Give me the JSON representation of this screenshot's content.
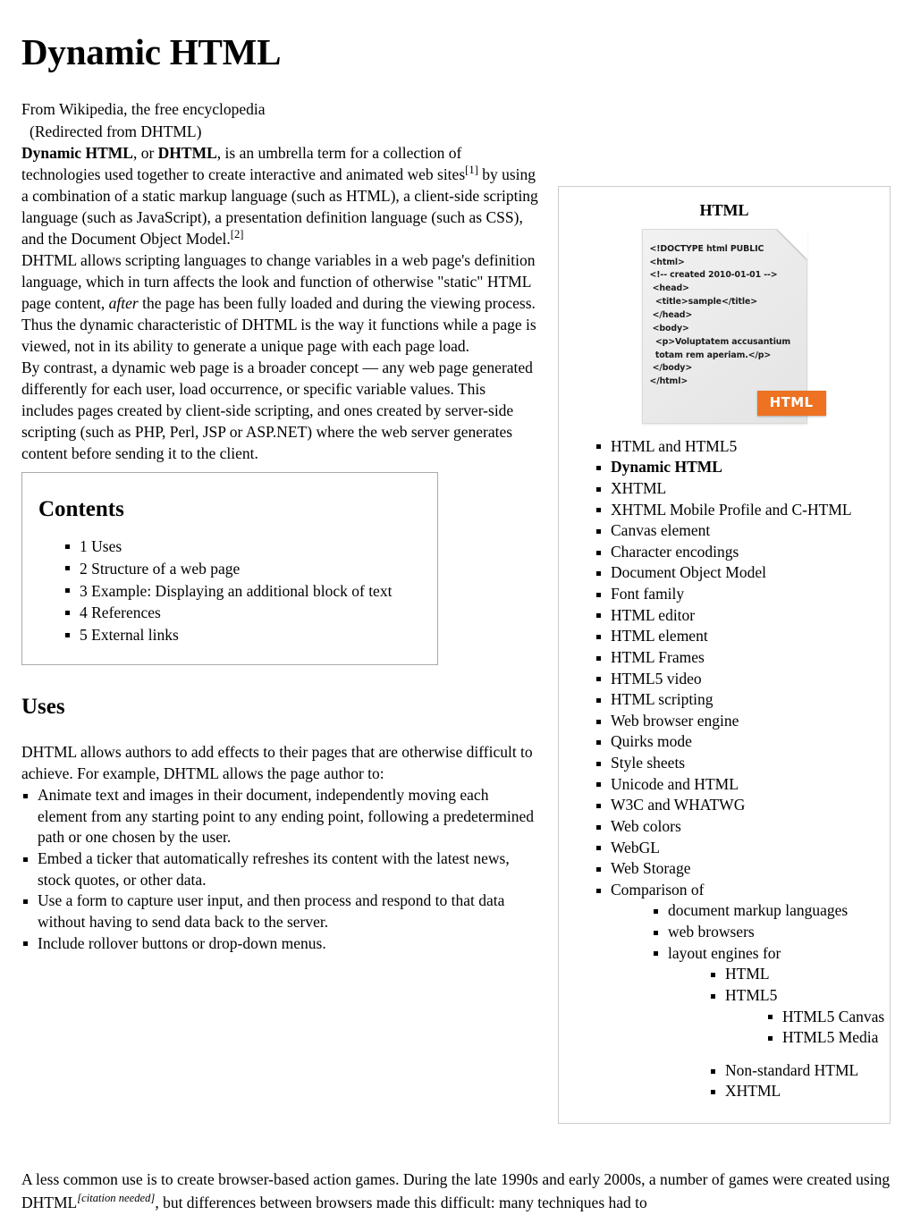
{
  "article": {
    "title": "Dynamic HTML",
    "site_line": "From Wikipedia, the free encyclopedia",
    "redirect_line": "(Redirected from DHTML)"
  },
  "lead": {
    "p1_bold_1": "Dynamic HTML",
    "p1_seg_1": ", or ",
    "p1_bold_2": "DHTML",
    "p1_seg_2": ", is an umbrella term for a collection of technologies used together to create interactive and animated web sites",
    "p1_ref_1": "[1]",
    "p1_seg_3": " by using a combination of a static markup language (such as HTML), a client-side scripting language (such as JavaScript), a presentation definition language (such as CSS), and the Document Object Model.",
    "p1_ref_2": "[2]",
    "p2_seg_1": "DHTML allows scripting languages to change variables in a web page's definition language, which in turn affects the look and function of otherwise \"static\" HTML page content, ",
    "p2_italic": "after",
    "p2_seg_2": " the page has been fully loaded and during the viewing process. Thus the dynamic characteristic of DHTML is the way it functions while a page is viewed, not in its ability to generate a unique page with each page load.",
    "p3": "By contrast, a dynamic web page is a broader concept — any web page generated differently for each user, load occurrence, or specific variable values. This includes pages created by client-side scripting, and ones created by server-side scripting (such as PHP, Perl, JSP or ASP.NET) where the web server generates content before sending it to the client."
  },
  "toc": {
    "heading": "Contents",
    "items": [
      "1 Uses",
      "2 Structure of a web page",
      "3 Example: Displaying an additional block of text",
      "4 References",
      "5 External links"
    ]
  },
  "uses_section": {
    "heading": "Uses",
    "intro": "DHTML allows authors to add effects to their pages that are otherwise difficult to achieve. For example, DHTML allows the page author to:",
    "items": [
      "Animate text and images in their document, independently moving each element from any starting point to any ending point, following a predetermined path or one chosen by the user.",
      "Embed a ticker that automatically refreshes its content with the latest news, stock quotes, or other data.",
      "Use a form to capture user input, and then process and respond to that data without having to send data back to the server.",
      "Include rollover buttons or drop-down menus."
    ]
  },
  "bottom_paragraph": {
    "seg_1": "A less common use is to create browser-based action games. During the late 1990s and early 2000s, a number of games were created using DHTML",
    "citation_needed": "[citation needed]",
    "seg_2": ", but differences between browsers made this difficult: many techniques had to"
  },
  "infobox": {
    "title": "HTML",
    "doc_code": "<!DOCTYPE html PUBLIC\n<html>\n<!-- created 2010-01-01 -->\n <head>\n  <title>sample</title>\n </head>\n <body>\n  <p>Voluptatem accusantium\n  totam rem aperiam.</p>\n </body>\n</html>",
    "badge_label": "HTML",
    "badge_color": "#ED7222",
    "nav_items": [
      {
        "label": "HTML and HTML5",
        "level": 1,
        "current": false
      },
      {
        "label": "Dynamic HTML",
        "level": 1,
        "current": true
      },
      {
        "label": "XHTML",
        "level": 1,
        "current": false
      },
      {
        "label": "XHTML Mobile Profile and C-HTML",
        "level": 1,
        "current": false
      },
      {
        "label": "Canvas element",
        "level": 1,
        "current": false
      },
      {
        "label": "Character encodings",
        "level": 1,
        "current": false
      },
      {
        "label": "Document Object Model",
        "level": 1,
        "current": false
      },
      {
        "label": "Font family",
        "level": 1,
        "current": false
      },
      {
        "label": "HTML editor",
        "level": 1,
        "current": false
      },
      {
        "label": "HTML element",
        "level": 1,
        "current": false
      },
      {
        "label": "HTML Frames",
        "level": 1,
        "current": false
      },
      {
        "label": "HTML5 video",
        "level": 1,
        "current": false
      },
      {
        "label": "HTML scripting",
        "level": 1,
        "current": false
      },
      {
        "label": "Web browser engine",
        "level": 1,
        "current": false
      },
      {
        "label": "Quirks mode",
        "level": 1,
        "current": false
      },
      {
        "label": "Style sheets",
        "level": 1,
        "current": false
      },
      {
        "label": "Unicode and HTML",
        "level": 1,
        "current": false
      },
      {
        "label": "W3C and WHATWG",
        "level": 1,
        "current": false
      },
      {
        "label": "Web colors",
        "level": 1,
        "current": false
      },
      {
        "label": "WebGL",
        "level": 1,
        "current": false
      },
      {
        "label": "Web Storage",
        "level": 1,
        "current": false
      },
      {
        "label": "Comparison of",
        "level": 1,
        "current": false
      },
      {
        "label": "document markup languages",
        "level": 2,
        "current": false
      },
      {
        "label": "web browsers",
        "level": 2,
        "current": false
      },
      {
        "label": "layout engines for",
        "level": 2,
        "current": false
      },
      {
        "label": "HTML",
        "level": 3,
        "current": false
      },
      {
        "label": "HTML5",
        "level": 3,
        "current": false
      },
      {
        "label": "HTML5 Canvas",
        "level": 4,
        "current": false
      },
      {
        "label": "HTML5 Media",
        "level": 4,
        "current": false
      },
      {
        "label": "Non-standard HTML",
        "level": 3,
        "current": false,
        "gap_before": true
      },
      {
        "label": "XHTML",
        "level": 3,
        "current": false
      }
    ]
  }
}
